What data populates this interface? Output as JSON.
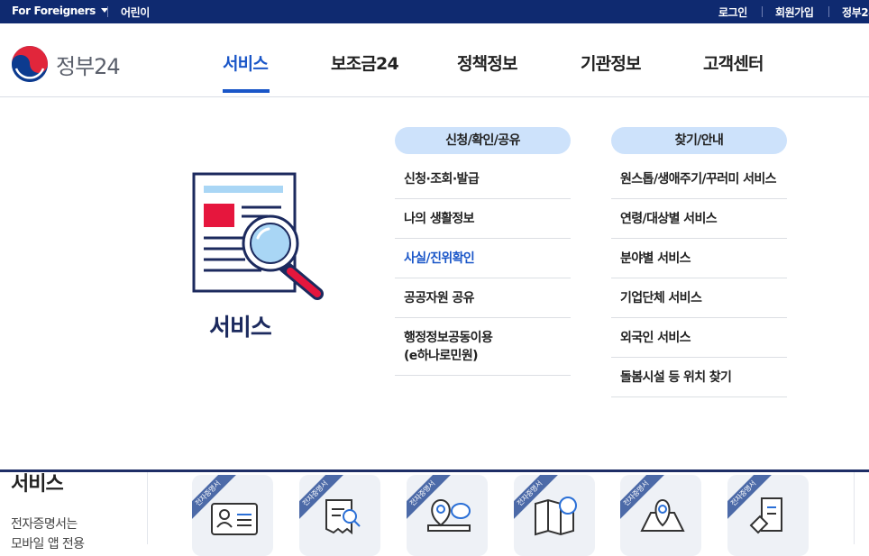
{
  "topbar": {
    "foreigners": "For Foreigners",
    "kids": "어린이",
    "login": "로그인",
    "signup": "회원가입",
    "gov24": "정부24"
  },
  "header": {
    "logo_text": "정부24",
    "nav": [
      {
        "label": "서비스",
        "active": true
      },
      {
        "label": "보조금24"
      },
      {
        "label": "정책정보"
      },
      {
        "label": "기관정보"
      },
      {
        "label": "고객센터"
      }
    ]
  },
  "menu": {
    "hero_title": "서비스",
    "col1": {
      "head": "신청/확인/공유",
      "items": [
        {
          "label": "신청·조회·발급"
        },
        {
          "label": "나의 생활정보"
        },
        {
          "label": "사실/진위확인",
          "active": true
        },
        {
          "label": "공공자원 공유"
        },
        {
          "label": "행정정보공동이용\n(e하나로민원)"
        }
      ]
    },
    "col2": {
      "head": "찾기/안내",
      "items": [
        {
          "label": "원스톱/생애주기/꾸러미 서비스"
        },
        {
          "label": "연령/대상별 서비스"
        },
        {
          "label": "분야별 서비스"
        },
        {
          "label": "기업단체 서비스"
        },
        {
          "label": "외국인 서비스"
        },
        {
          "label": "돌봄시설 등 위치 찾기"
        }
      ]
    }
  },
  "background": {
    "title": "서비스",
    "desc_line1": "전자증명서는",
    "desc_line2": "모바일 앱 전용",
    "ribbon": "전자증명서"
  },
  "colors": {
    "topbar": "#0f2a70",
    "accent": "#1a56c8",
    "pill": "#cde2fb"
  }
}
